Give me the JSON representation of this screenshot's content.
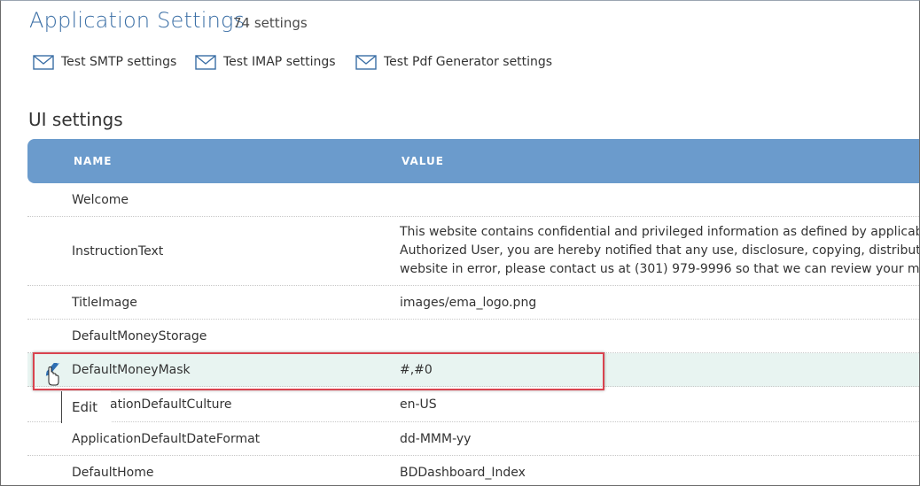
{
  "page": {
    "title": "Application Settings",
    "count": "74 settings"
  },
  "test_links": [
    {
      "label": "Test SMTP settings",
      "icon": "mail-icon"
    },
    {
      "label": "Test IMAP settings",
      "icon": "mail-icon"
    },
    {
      "label": "Test Pdf Generator settings",
      "icon": "mail-icon"
    }
  ],
  "section": {
    "title": "UI settings"
  },
  "table": {
    "headers": {
      "name": "NAME",
      "value": "VALUE"
    },
    "rows": [
      {
        "name": "Welcome",
        "value": ""
      },
      {
        "name": "InstructionText",
        "value_lines": [
          "This website contains confidential and privileged information as defined by applicable",
          "Authorized User, you are hereby notified that any use, disclosure, copying, distribution",
          "website in error, please contact us at (301) 979-9996 so that we can review your meth"
        ]
      },
      {
        "name": "TitleImage",
        "value": "images/ema_logo.png"
      },
      {
        "name": "DefaultMoneyStorage",
        "value": ""
      },
      {
        "name": "DefaultMoneyMask",
        "value": "#,#0"
      },
      {
        "name": "ApplicationDefaultCulture",
        "name_visible": "ationDefaultCulture",
        "value": "en-US"
      },
      {
        "name": "ApplicationDefaultDateFormat",
        "value": "dd-MMM-yy"
      },
      {
        "name": "DefaultHome",
        "value": "BDDashboard_Index"
      }
    ]
  },
  "tooltip": {
    "label": "Edit"
  },
  "colors": {
    "title": "#3a6ea5",
    "header_bg": "#6b9bcc",
    "highlight_row": "#e8f4f1",
    "highlight_border": "#d9434f",
    "edit_icon": "#2f6fb3"
  }
}
